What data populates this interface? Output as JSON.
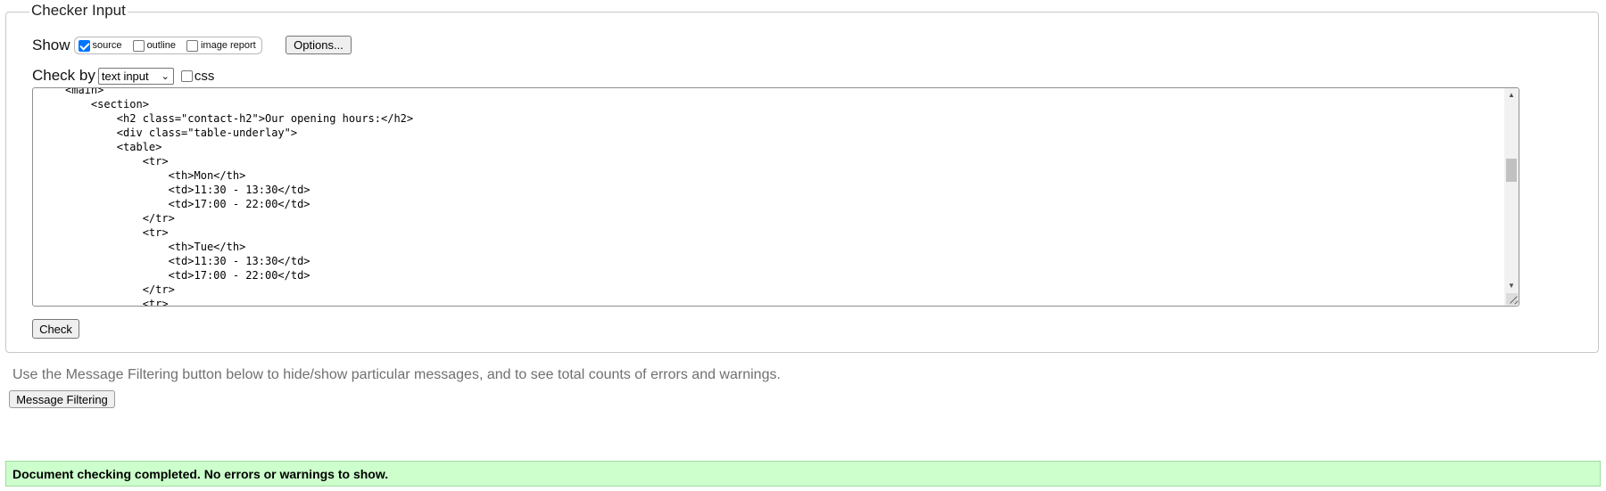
{
  "checker": {
    "legend": "Checker Input",
    "show": {
      "label": "Show",
      "options": [
        {
          "label": "source",
          "checked": true
        },
        {
          "label": "outline",
          "checked": false
        },
        {
          "label": "image report",
          "checked": false
        }
      ],
      "options_button": "Options..."
    },
    "check_by": {
      "label": "Check by",
      "selected": "text input",
      "css_label": "css",
      "css_checked": false
    },
    "source_code": "<main>\n    <section>\n        <h2 class=\"contact-h2\">Our opening hours:</h2>\n        <div class=\"table-underlay\">\n        <table>\n            <tr>\n                <th>Mon</th>\n                <td>11:30 - 13:30</td>\n                <td>17:00 - 22:00</td>\n            </tr>\n            <tr>\n                <th>Tue</th>\n                <td>11:30 - 13:30</td>\n                <td>17:00 - 22:00</td>\n            </tr>\n            <tr>",
    "check_button": "Check"
  },
  "filtering": {
    "note": "Use the Message Filtering button below to hide/show particular messages, and to see total counts of errors and warnings.",
    "button": "Message Filtering"
  },
  "result": {
    "message": "Document checking completed. No errors or warnings to show.",
    "color": "#ccffcc"
  }
}
